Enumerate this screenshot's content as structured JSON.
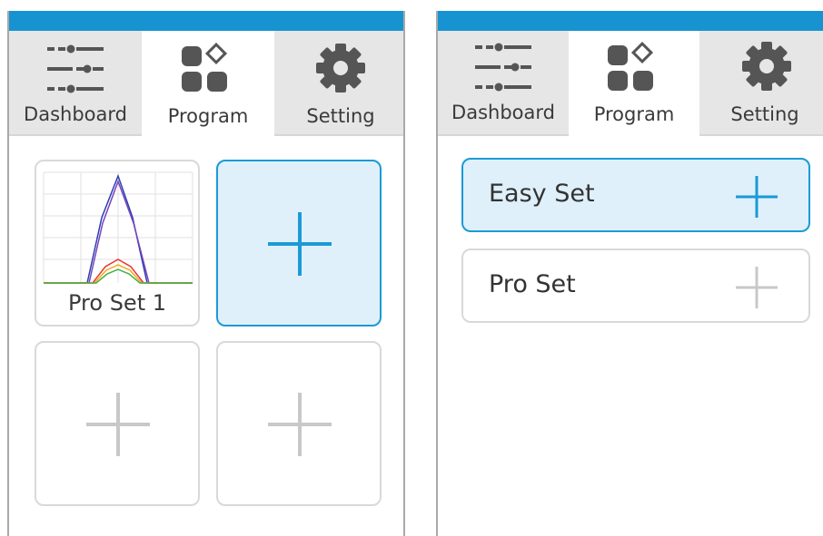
{
  "colors": {
    "accent": "#1793d1",
    "selected_fill": "#dff0fa",
    "selected_border": "#1a9ad6",
    "inactive_plus": "#c8c8c8",
    "icon_dark": "#555555"
  },
  "left_panel": {
    "tabs": [
      {
        "label": "Dashboard",
        "icon": "sliders-icon",
        "active": false
      },
      {
        "label": "Program",
        "icon": "program-blocks-icon",
        "active": true
      },
      {
        "label": "Setting",
        "icon": "gear-icon",
        "active": false
      }
    ],
    "grid": [
      {
        "type": "program",
        "label": "Pro Set 1"
      },
      {
        "type": "add",
        "selected": true,
        "icon": "plus-icon"
      },
      {
        "type": "add",
        "selected": false,
        "icon": "plus-icon"
      },
      {
        "type": "add",
        "selected": false,
        "icon": "plus-icon"
      }
    ]
  },
  "right_panel": {
    "tabs": [
      {
        "label": "Dashboard",
        "icon": "sliders-icon",
        "active": false
      },
      {
        "label": "Program",
        "icon": "program-blocks-icon",
        "active": true
      },
      {
        "label": "Setting",
        "icon": "gear-icon",
        "active": false
      }
    ],
    "rows": [
      {
        "label": "Easy Set",
        "selected": true,
        "icon": "plus-icon"
      },
      {
        "label": "Pro Set",
        "selected": false,
        "icon": "plus-icon"
      }
    ]
  }
}
